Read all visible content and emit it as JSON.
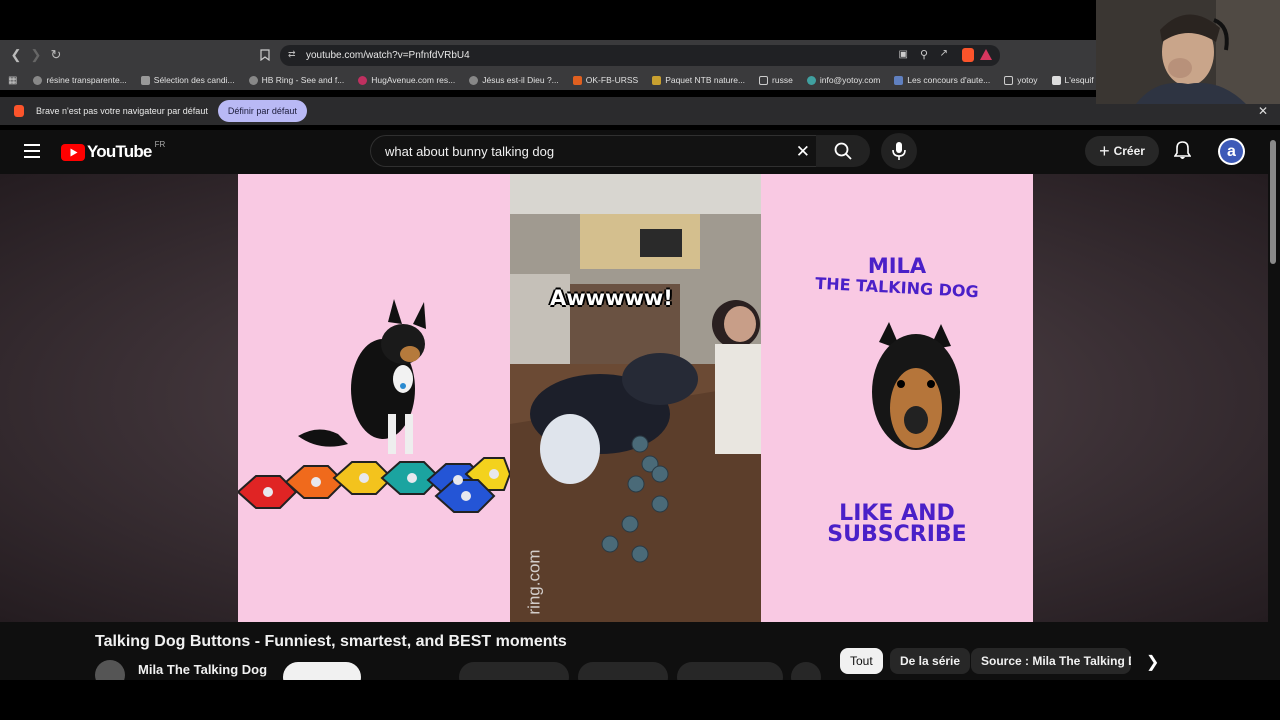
{
  "browser": {
    "url": "youtube.com/watch?v=PnfnfdVRbU4",
    "bookmarks": [
      {
        "label": "résine transparente...",
        "color": "#888888"
      },
      {
        "label": "Sélection des candi...",
        "color": "#999999"
      },
      {
        "label": "HB Ring - See and f...",
        "color": "#888888"
      },
      {
        "label": "HugAvenue.com res...",
        "color": "#c03060"
      },
      {
        "label": "Jésus est-il Dieu ?...",
        "color": "#888888"
      },
      {
        "label": "OK-FB-URSS",
        "color": "#e06020"
      },
      {
        "label": "Paquet NTB nature...",
        "color": "#c8a030"
      },
      {
        "label": "russe",
        "color": "#cccccc"
      },
      {
        "label": "info@yotoy.com",
        "color": "#40a0a0"
      },
      {
        "label": "Les concours d'aute...",
        "color": "#6080c0"
      },
      {
        "label": "yotoy",
        "color": "#cccccc"
      },
      {
        "label": "L'esquif fantôme eB...",
        "color": "#cccccc"
      }
    ],
    "info_bar_text": "Brave n'est pas votre navigateur par défaut",
    "default_button": "Définir par défaut"
  },
  "youtube": {
    "logo_text": "YouTube",
    "region": "FR",
    "search_query": "what about bunny talking dog",
    "create_label": "Créer",
    "avatar_letter": "a",
    "video_title": "Talking Dog Buttons - Funniest, smartest, and BEST moments",
    "channel_name": "Mila The Talking Dog",
    "chips": [
      "Tout",
      "De la série",
      "Source : Mila The Talking Do"
    ]
  },
  "video_frame": {
    "caption": "Awwwww!",
    "watermark": "ring.com",
    "right_title_line1": "MILA",
    "right_title_line2": "THE TALKING DOG",
    "cta_line1": "LIKE AND",
    "cta_line2": "SUBSCRIBE"
  },
  "colors": {
    "pink_bg": "#f9c9e3",
    "mila_purple": "#4a20c8",
    "yt_red": "#ff0000"
  }
}
